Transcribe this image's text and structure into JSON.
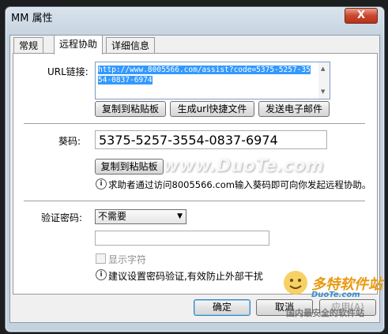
{
  "window": {
    "title": "MM 属性",
    "close_label": "X"
  },
  "tabs": [
    {
      "label": "常规",
      "active": false
    },
    {
      "label": "远程协助",
      "active": true
    },
    {
      "label": "详细信息",
      "active": false
    }
  ],
  "url": {
    "label": "URL链接:",
    "value": "http://www.8005566.com/assist?code=5375-5257-3554-0837-6974",
    "copy_button": "复制到粘贴板",
    "shortcut_button": "生成url快捷文件",
    "email_button": "发送电子邮件"
  },
  "code": {
    "label": "葵码:",
    "value": "5375-5257-3554-0837-6974",
    "copy_button": "复制到粘贴板",
    "info": "求助者通过访问8005566.com输入葵码即可向你发起远程协助。"
  },
  "password": {
    "label": "验证密码:",
    "selected": "不需要",
    "value": "",
    "show_chars_label": "显示字符",
    "show_chars_checked": false,
    "info": "建议设置密码验证,有效防止外部干扰"
  },
  "footer": {
    "ok": "确定",
    "cancel": "取消",
    "apply": "应用(A)"
  },
  "watermarks": {
    "center": "www.DuoTe.com",
    "logo": "多特软件站",
    "logo_url": "DuoTe.com",
    "logo_caption": "国内最安全的软件站"
  },
  "colors": {
    "selection": "#3399ff",
    "close": "#c9452c"
  }
}
